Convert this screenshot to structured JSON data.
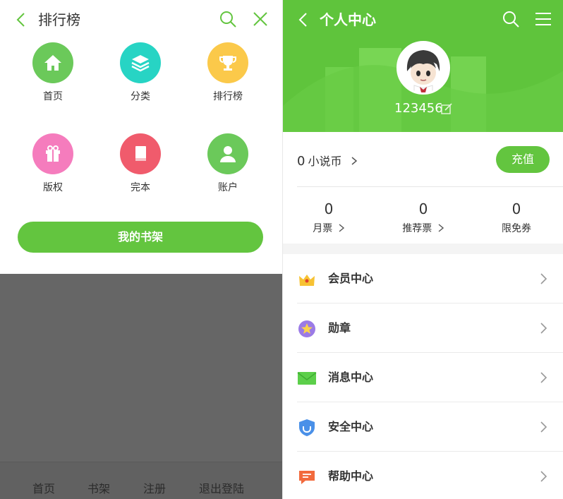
{
  "left": {
    "header": {
      "title": "排行榜"
    },
    "grid": [
      {
        "label": "首页",
        "icon": "home-icon",
        "color": "#6bc95a"
      },
      {
        "label": "分类",
        "icon": "layers-icon",
        "color": "#27d4c4"
      },
      {
        "label": "排行榜",
        "icon": "trophy-icon",
        "color": "#fbc94a"
      },
      {
        "label": "版权",
        "icon": "gift-icon",
        "color": "#f57cbd"
      },
      {
        "label": "完本",
        "icon": "book-icon",
        "color": "#f05b6c"
      },
      {
        "label": "账户",
        "icon": "user-icon",
        "color": "#6bc95a"
      }
    ],
    "shelf_button": "我的书架",
    "footer": [
      "首页",
      "书架",
      "注册",
      "退出登陆"
    ]
  },
  "right": {
    "header": {
      "title": "个人中心"
    },
    "user": {
      "id": "123456"
    },
    "coins": {
      "value": "0",
      "label": "小说币"
    },
    "recharge_label": "充值",
    "stats": [
      {
        "value": "0",
        "label": "月票"
      },
      {
        "value": "0",
        "label": "推荐票"
      },
      {
        "value": "0",
        "label": "限免券"
      }
    ],
    "menu": [
      {
        "label": "会员中心",
        "icon": "crown-icon"
      },
      {
        "label": "勋章",
        "icon": "medal-icon"
      },
      {
        "label": "消息中心",
        "icon": "envelope-icon"
      },
      {
        "label": "安全中心",
        "icon": "shield-icon"
      },
      {
        "label": "帮助中心",
        "icon": "chat-help-icon"
      }
    ]
  },
  "colors": {
    "accent": "#63c53f",
    "header_green": "#5fc43c",
    "overlay": "#666666"
  }
}
